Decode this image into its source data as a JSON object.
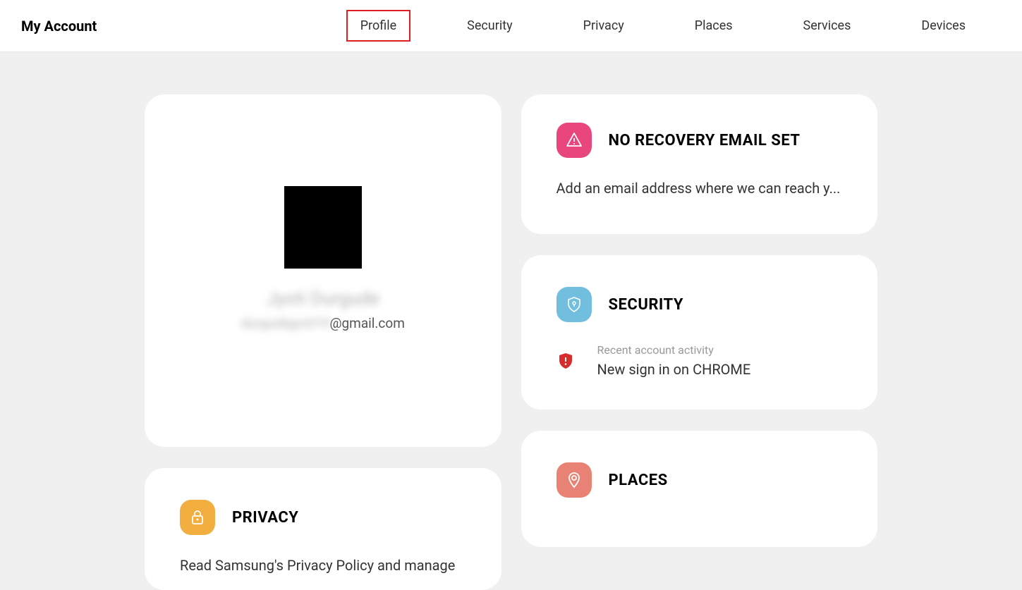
{
  "header": {
    "title": "My Account",
    "nav": [
      {
        "label": "Profile",
        "active": true
      },
      {
        "label": "Security",
        "active": false
      },
      {
        "label": "Privacy",
        "active": false
      },
      {
        "label": "Places",
        "active": false
      },
      {
        "label": "Services",
        "active": false
      },
      {
        "label": "Devices",
        "active": false
      }
    ]
  },
  "profile": {
    "name": "Jyoti Durgude",
    "email_prefix": "durgudejyoti19",
    "email_domain": "@gmail.com"
  },
  "cards": {
    "recovery": {
      "title": "NO RECOVERY EMAIL SET",
      "desc": "Add an email address where we can reach y..."
    },
    "security": {
      "title": "SECURITY",
      "activity_label": "Recent account activity",
      "activity_value": "New sign in on CHROME"
    },
    "privacy": {
      "title": "PRIVACY",
      "desc": "Read Samsung's Privacy Policy and manage"
    },
    "places": {
      "title": "PLACES"
    }
  }
}
